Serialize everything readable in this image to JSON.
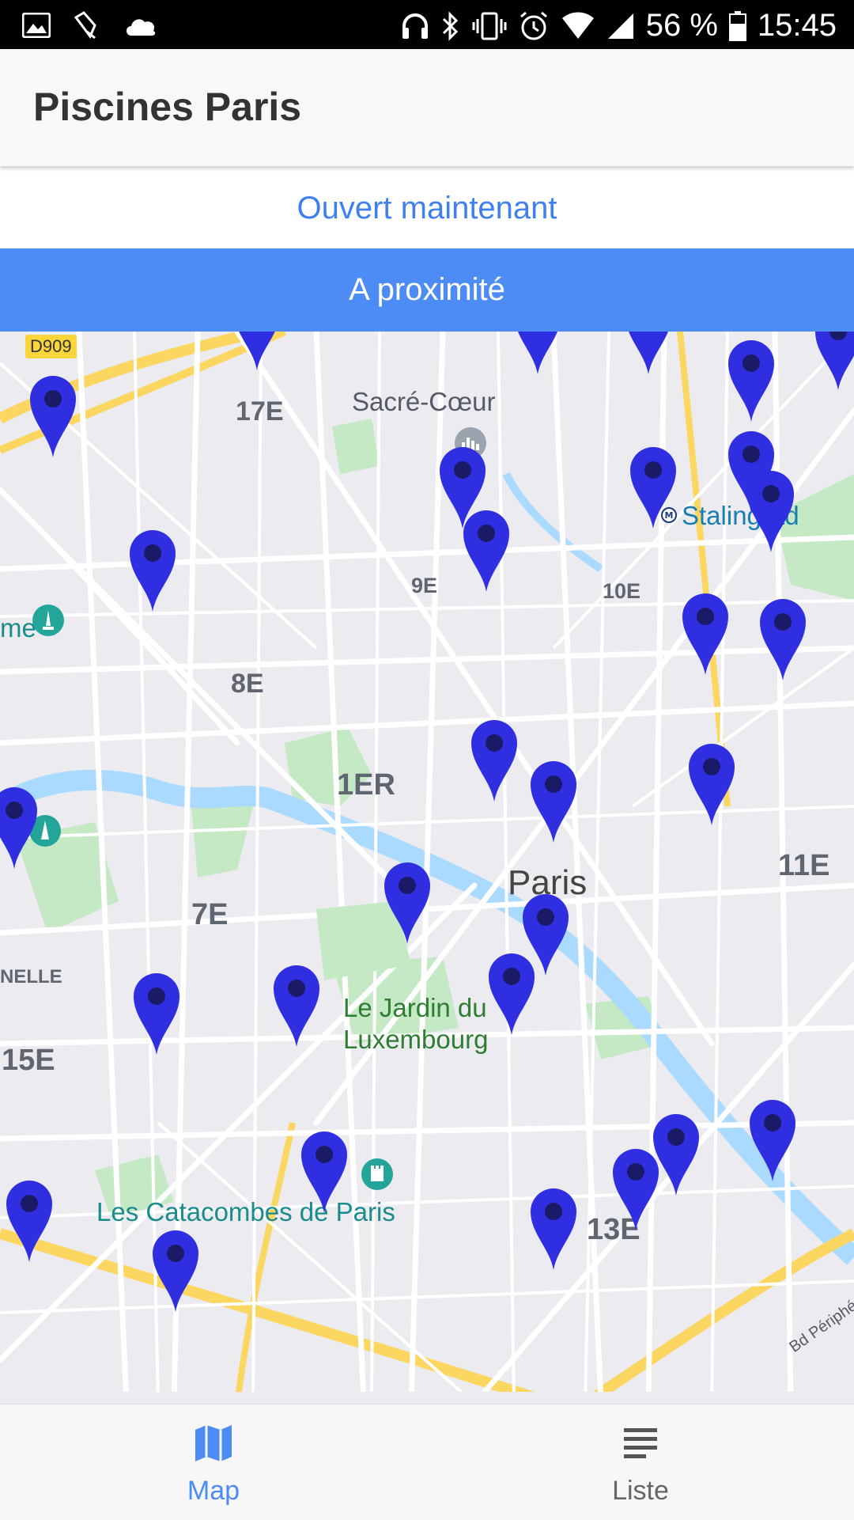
{
  "status_bar": {
    "battery": "56 %",
    "time": "15:45",
    "icons": [
      "image-icon",
      "satellite-icon",
      "cloud-icon",
      "headphones-icon",
      "bluetooth-icon",
      "vibrate-icon",
      "alarm-icon",
      "wifi-icon",
      "signal-icon",
      "battery-icon"
    ]
  },
  "app": {
    "title": "Piscines Paris"
  },
  "filters": {
    "open_now": "Ouvert maintenant",
    "nearby": "A proximité"
  },
  "map": {
    "road_badge": "D909",
    "labels": {
      "d17": "17E",
      "sacre": "Sacré-Cœur",
      "d9": "9E",
      "d10": "10E",
      "stalingrad": "Stalingrad",
      "d8": "8E",
      "d1": "1ER",
      "paris": "Paris",
      "d11": "11E",
      "d7": "7E",
      "nelle": "NELLE",
      "jardin1": "Le Jardin du",
      "jardin2": "Luxembourg",
      "d15": "15E",
      "catacombes": "Les Catacombes de Paris",
      "d13": "13E",
      "periph": "Bd Périphérie",
      "me": "me"
    },
    "pin_count": 31,
    "colors": {
      "pin": "#2f2ee0",
      "pin_dot": "#1a1a66",
      "water": "#aadaff",
      "park": "#c5e8c5",
      "road": "#ffffff",
      "major_road": "#fbd661"
    }
  },
  "bottom_nav": {
    "map_label": "Map",
    "list_label": "Liste",
    "active_color": "#4d8cf5",
    "inactive_color": "#666666"
  }
}
